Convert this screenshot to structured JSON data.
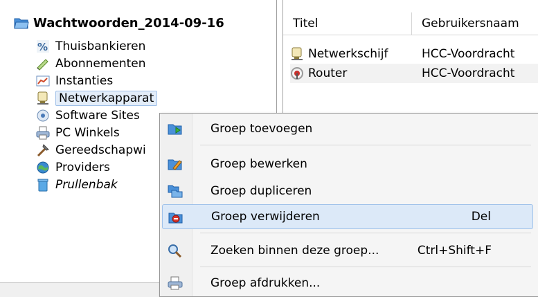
{
  "tree": {
    "root_label": "Wachtwoorden_2014-09-16",
    "items": [
      {
        "label": "Thuisbankieren",
        "icon": "percent-icon"
      },
      {
        "label": "Abonnementen",
        "icon": "pen-icon"
      },
      {
        "label": "Instanties",
        "icon": "chart-icon"
      },
      {
        "label": "Netwerkapparat",
        "icon": "network-icon"
      },
      {
        "label": "Software Sites",
        "icon": "disc-icon"
      },
      {
        "label": "PC Winkels",
        "icon": "printer-icon"
      },
      {
        "label": "Gereedschapwi",
        "icon": "tools-icon"
      },
      {
        "label": "Providers",
        "icon": "globe-icon"
      },
      {
        "label": "Prullenbak",
        "icon": "trash-icon"
      }
    ]
  },
  "list": {
    "columns": [
      "Titel",
      "Gebruikersnaam"
    ],
    "rows": [
      {
        "title": "Netwerkschijf",
        "user": "HCC-Voordracht",
        "icon": "network-icon"
      },
      {
        "title": "Router",
        "user": "HCC-Voordracht",
        "icon": "router-icon"
      }
    ]
  },
  "context_menu": {
    "items": [
      {
        "label": "Groep toevoegen",
        "shortcut": "",
        "icon": "folder-add-icon"
      },
      {
        "label": "Groep bewerken",
        "shortcut": "",
        "icon": "folder-edit-icon"
      },
      {
        "label": "Groep dupliceren",
        "shortcut": "",
        "icon": "duplicate-icon"
      },
      {
        "label": "Groep verwijderen",
        "shortcut": "Del",
        "icon": "folder-delete-icon"
      },
      {
        "label": "Zoeken binnen deze groep...",
        "shortcut": "Ctrl+Shift+F",
        "icon": "search-icon"
      },
      {
        "label": "Groep afdrukken...",
        "shortcut": "",
        "icon": "printer-icon"
      }
    ]
  },
  "colors": {
    "selection": "#dce9f8",
    "selection_border": "#9ec1ea"
  }
}
